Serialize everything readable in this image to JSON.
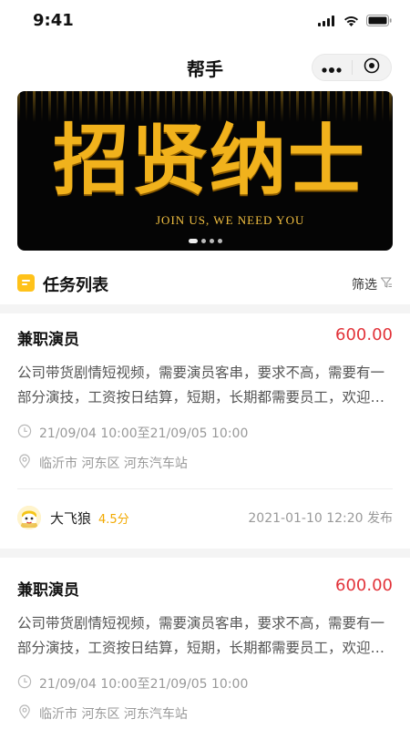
{
  "status": {
    "time": "9:41"
  },
  "nav": {
    "title": "帮手"
  },
  "banner": {
    "title": "招贤纳士",
    "subtitle": "JOIN US, WE NEED YOU"
  },
  "section": {
    "title": "任务列表",
    "filter_label": "筛选"
  },
  "tasks": [
    {
      "title": "兼职演员",
      "price": "600.00",
      "description": "公司带货剧情短视频，需要演员客串，要求不高，需要有一部分演技，工资按日结算，短期，长期都需要员工，欢迎咨询",
      "time": "21/09/04 10:00至21/09/05 10:00",
      "location": "临沂市 河东区 河东汽车站",
      "poster": {
        "name": "大飞狼",
        "score": "4.5分",
        "published": "2021-01-10 12:20 发布"
      }
    },
    {
      "title": "兼职演员",
      "price": "600.00",
      "description": "公司带货剧情短视频，需要演员客串，要求不高，需要有一部分演技，工资按日结算，短期，长期都需要员工，欢迎咨询",
      "time": "21/09/04 10:00至21/09/05 10:00",
      "location": "临沂市 河东区 河东汽车站"
    }
  ],
  "icons": {
    "signal": "cellular-signal-icon",
    "wifi": "wifi-icon",
    "battery": "battery-icon",
    "more": "more-dots-icon",
    "close": "target-close-icon",
    "filter": "filter-icon",
    "clock": "clock-icon",
    "location": "location-pin-icon"
  },
  "colors": {
    "price": "#e2333a",
    "accent": "#ffc21a",
    "score": "#f2a900"
  }
}
